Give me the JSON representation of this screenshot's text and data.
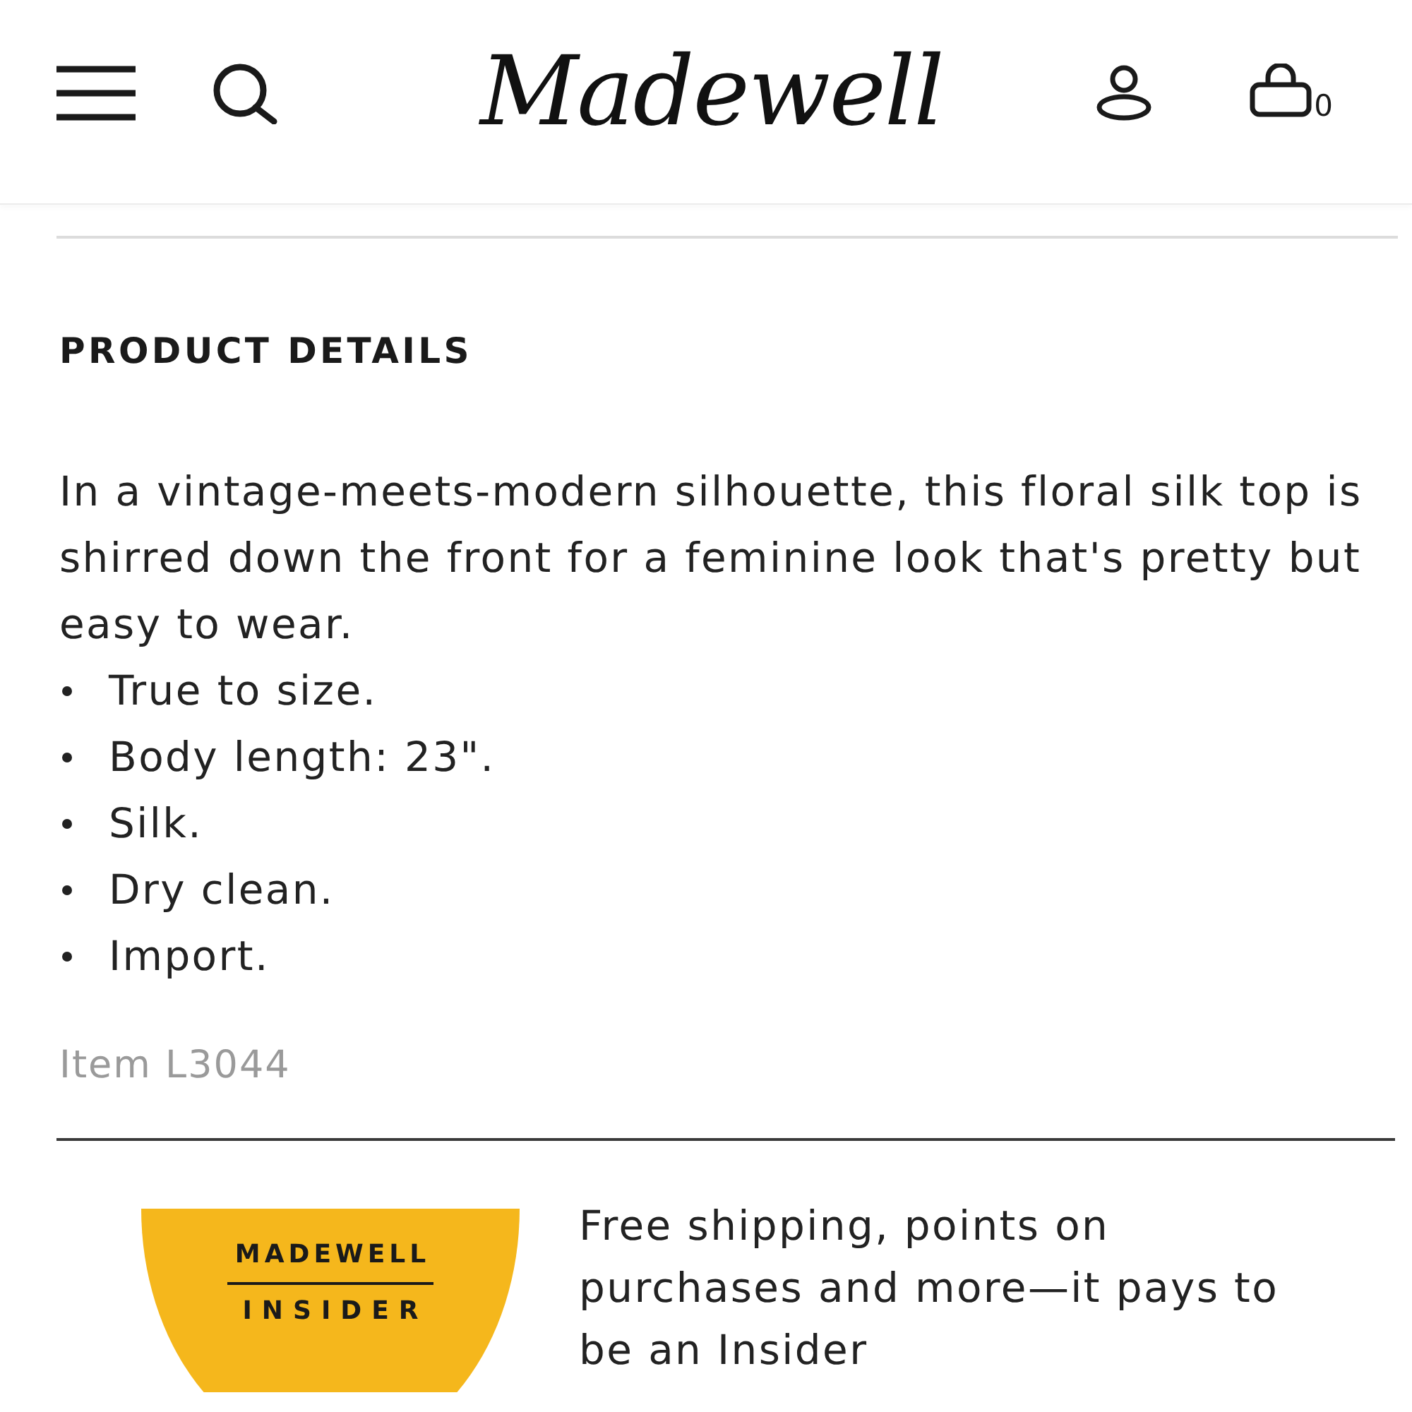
{
  "header": {
    "logo": "Madewell",
    "cart_count": "0"
  },
  "details": {
    "heading": "PRODUCT DETAILS",
    "description": "In a vintage-meets-modern silhouette, this floral silk top is shirred down the front for a feminine look that's pretty but easy to wear.",
    "bullets": [
      "True to size.",
      "Body length: 23\".",
      "Silk.",
      "Dry clean.",
      "Import."
    ],
    "item_number": "Item L3044"
  },
  "insider": {
    "badge_top": "MADEWELL",
    "badge_bottom": "INSIDER",
    "text": "Free shipping, points on purchases and more—it pays to be an Insider"
  }
}
